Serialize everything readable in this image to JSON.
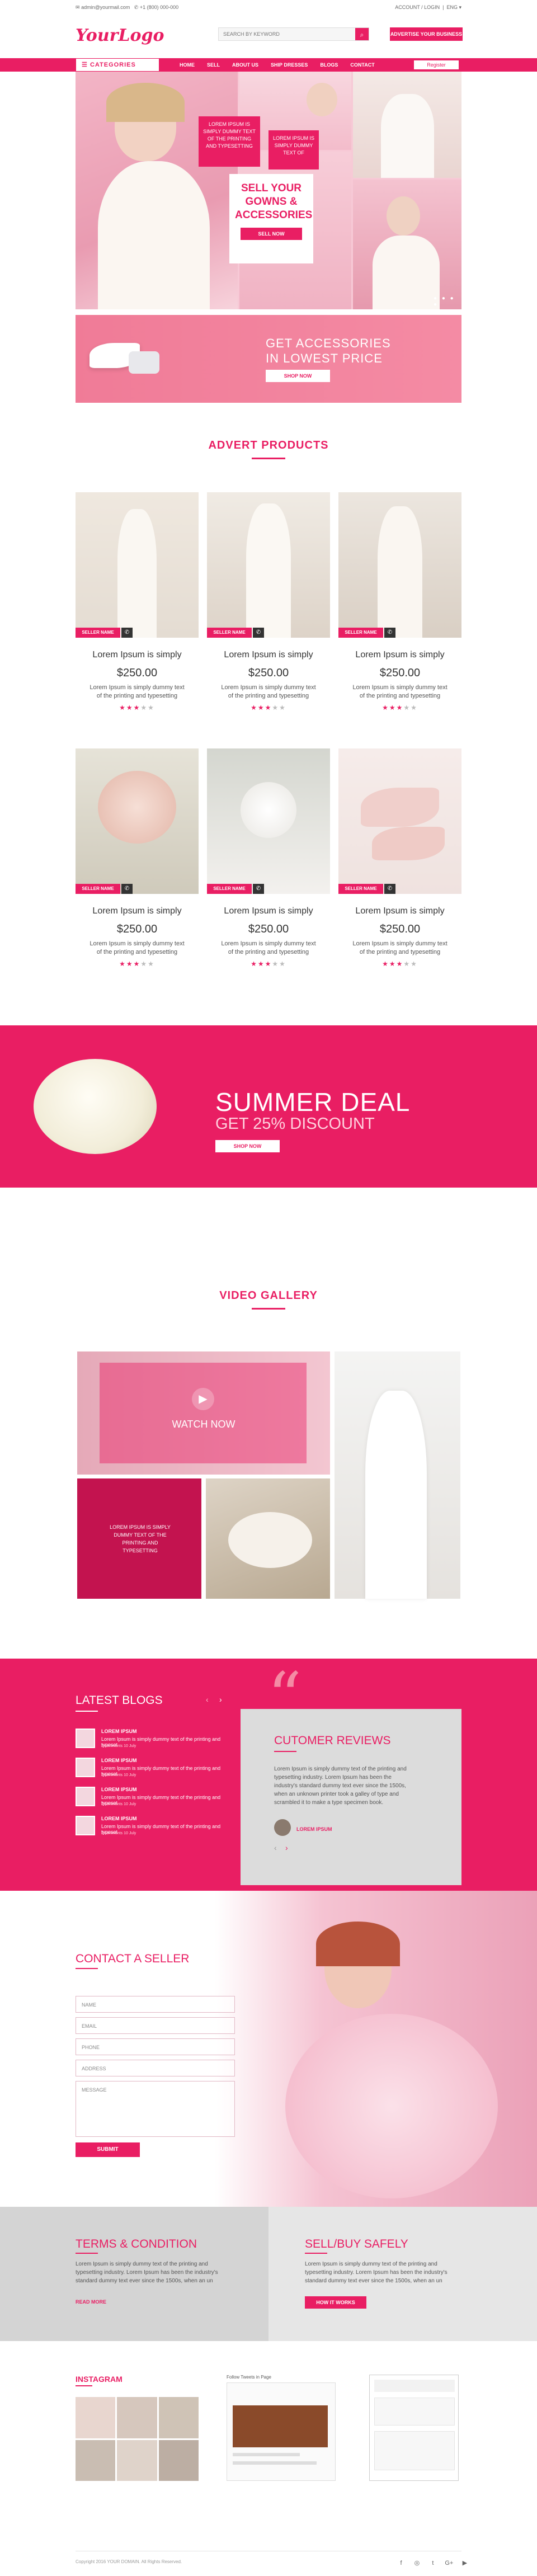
{
  "topbar": {
    "email": "admin@yourmail.com",
    "phone": "+1 (800) 000-000",
    "account": "ACCOUNT / LOGIN",
    "language": "ENG"
  },
  "header": {
    "logo": "YourLogo",
    "search_placeholder": "SEARCH BY KEYWORD",
    "advertise_label": "ADVERTISE YOUR BUSINESS"
  },
  "nav": {
    "categories_label": "CATEGORIES",
    "links": [
      "HOME",
      "SELL",
      "ABOUT US",
      "SHIP DRESSES",
      "BLOGS",
      "CONTACT"
    ],
    "register_label": "Register"
  },
  "hero": {
    "box1": "LOREM IPSUM IS SIMPLY DUMMY TEXT OF THE PRINTING AND TYPESETTING",
    "box2": "LOREM IPSUM IS SIMPLY DUMMY TEXT OF",
    "sell_title": "SELL YOUR GOWNS & ACCESSORIES",
    "sell_button": "SELL NOW"
  },
  "promo": {
    "title_line1": "GET ACCESSORIES",
    "title_line2": "IN LOWEST PRICE",
    "button": "SHOP NOW"
  },
  "advert": {
    "title": "ADVERT PRODUCTS",
    "seller_label": "SELLER NAME",
    "products": [
      {
        "title": "Lorem Ipsum is simply",
        "price": "$250.00",
        "desc": "Lorem Ipsum is simply dummy text of the printing and typesetting",
        "rating": 3
      },
      {
        "title": "Lorem Ipsum is simply",
        "price": "$250.00",
        "desc": "Lorem Ipsum is simply dummy text of the printing and typesetting",
        "rating": 3
      },
      {
        "title": "Lorem Ipsum is simply",
        "price": "$250.00",
        "desc": "Lorem Ipsum is simply dummy text of the printing and typesetting",
        "rating": 3
      },
      {
        "title": "Lorem Ipsum is simply",
        "price": "$250.00",
        "desc": "Lorem Ipsum is simply dummy text of the printing and typesetting",
        "rating": 3
      },
      {
        "title": "Lorem Ipsum is simply",
        "price": "$250.00",
        "desc": "Lorem Ipsum is simply dummy text of the printing and typesetting",
        "rating": 3
      },
      {
        "title": "Lorem Ipsum is simply",
        "price": "$250.00",
        "desc": "Lorem Ipsum is simply dummy text of the printing and typesetting",
        "rating": 3
      }
    ]
  },
  "deal": {
    "title": "SUMMER DEAL",
    "subtitle": "GET 25% DISCOUNT",
    "button": "SHOP NOW"
  },
  "video": {
    "title": "VIDEO GALLERY",
    "watch": "WATCH NOW",
    "text": "LOREM IPSUM IS SIMPLY DUMMY TEXT OF THE PRINTING AND TYPESETTING"
  },
  "blogs": {
    "title": "LATEST BLOGS",
    "items": [
      {
        "title": "LOREM IPSUM",
        "text": "Lorem Ipsum is simply dummy text of the printing and typeset",
        "meta": "2 comments   10 July"
      },
      {
        "title": "LOREM IPSUM",
        "text": "Lorem Ipsum is simply dummy text of the printing and typeset",
        "meta": "2 comments   10 July"
      },
      {
        "title": "LOREM IPSUM",
        "text": "Lorem Ipsum is simply dummy text of the printing and typeset",
        "meta": "2 comments   10 July"
      },
      {
        "title": "LOREM IPSUM",
        "text": "Lorem Ipsum is simply dummy text of the printing and typeset",
        "meta": "2 comments   10 July"
      }
    ]
  },
  "reviews": {
    "title": "CUTOMER REVIEWS",
    "text": "Lorem Ipsum is simply dummy text of the printing and typesetting industry. Lorem Ipsum has been the industry's standard dummy text ever since the 1500s, when an unknown printer took a galley of type and scrambled it to make a type specimen book.",
    "author": "LOREM IPSUM"
  },
  "contact": {
    "title": "CONTACT A SELLER",
    "fields": [
      "NAME",
      "EMAIL",
      "PHONE",
      "ADDRESS",
      "MESSAGE"
    ],
    "submit": "SUBMIT"
  },
  "terms": {
    "title": "TERMS & CONDITION",
    "text": "Lorem Ipsum is simply dummy text of the printing and typesetting industry. Lorem Ipsum has been the industry's standard dummy text ever since the 1500s, when an un",
    "link": "READ MORE"
  },
  "safely": {
    "title": "SELL/BUY SAFELY",
    "text": "Lorem Ipsum is simply dummy text of the printing and typesetting industry. Lorem Ipsum has been the industry's standard dummy text ever since the 1500s, when an un",
    "button": "HOW IT WORKS"
  },
  "footer": {
    "instagram": "INSTAGRAM",
    "twitter": "Follow Tweets in Page",
    "copyright": "Copyright 2016 YOUR DOMAIN. All Rights Reserved.",
    "socials": [
      "facebook-icon",
      "instagram-icon",
      "twitter-icon",
      "google-plus-icon",
      "youtube-icon"
    ]
  },
  "colors": {
    "accent": "#e91e63",
    "light_pink": "#f48ba4",
    "grey": "#d6d6d6"
  }
}
